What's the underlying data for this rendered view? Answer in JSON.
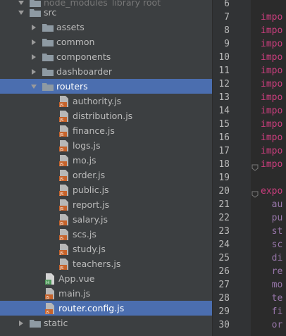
{
  "tree": {
    "top_row": {
      "label": "node_modules",
      "suffix": "library root"
    },
    "items": [
      {
        "label": "src",
        "kind": "folder",
        "depth": 1,
        "expanded": true,
        "selected": false
      },
      {
        "label": "assets",
        "kind": "folder",
        "depth": 2,
        "expanded": false,
        "selected": false
      },
      {
        "label": "common",
        "kind": "folder",
        "depth": 2,
        "expanded": false,
        "selected": false
      },
      {
        "label": "components",
        "kind": "folder",
        "depth": 2,
        "expanded": false,
        "selected": false
      },
      {
        "label": "dashboarder",
        "kind": "folder",
        "depth": 2,
        "expanded": false,
        "selected": false
      },
      {
        "label": "routers",
        "kind": "folder",
        "depth": 2,
        "expanded": true,
        "selected": true
      },
      {
        "label": "authority.js",
        "kind": "js",
        "depth": 3,
        "selected": false
      },
      {
        "label": "distribution.js",
        "kind": "js",
        "depth": 3,
        "selected": false
      },
      {
        "label": "finance.js",
        "kind": "js",
        "depth": 3,
        "selected": false
      },
      {
        "label": "logs.js",
        "kind": "js",
        "depth": 3,
        "selected": false
      },
      {
        "label": "mo.js",
        "kind": "js",
        "depth": 3,
        "selected": false
      },
      {
        "label": "order.js",
        "kind": "js",
        "depth": 3,
        "selected": false
      },
      {
        "label": "public.js",
        "kind": "js",
        "depth": 3,
        "selected": false
      },
      {
        "label": "report.js",
        "kind": "js",
        "depth": 3,
        "selected": false
      },
      {
        "label": "salary.js",
        "kind": "js",
        "depth": 3,
        "selected": false
      },
      {
        "label": "scs.js",
        "kind": "js",
        "depth": 3,
        "selected": false
      },
      {
        "label": "study.js",
        "kind": "js",
        "depth": 3,
        "selected": false
      },
      {
        "label": "teachers.js",
        "kind": "js",
        "depth": 3,
        "selected": false
      },
      {
        "label": "App.vue",
        "kind": "vue",
        "depth": 2,
        "selected": false
      },
      {
        "label": "main.js",
        "kind": "js",
        "depth": 2,
        "selected": false
      },
      {
        "label": "router.config.js",
        "kind": "js",
        "depth": 2,
        "selected": true
      },
      {
        "label": "static",
        "kind": "folder",
        "depth": 1,
        "expanded": false,
        "selected": false
      }
    ]
  },
  "editor": {
    "line_numbers": [
      "6",
      "7",
      "8",
      "9",
      "10",
      "11",
      "12",
      "13",
      "14",
      "15",
      "16",
      "17",
      "18",
      "19",
      "20",
      "21",
      "22",
      "23",
      "24",
      "25",
      "26",
      "27",
      "28",
      "29",
      "30"
    ],
    "lines": [
      {
        "text": "",
        "cls": ""
      },
      {
        "text": "impo",
        "cls": "kw"
      },
      {
        "text": "impo",
        "cls": "kw"
      },
      {
        "text": "impo",
        "cls": "kw"
      },
      {
        "text": "impo",
        "cls": "kw"
      },
      {
        "text": "impo",
        "cls": "kw"
      },
      {
        "text": "impo",
        "cls": "kw"
      },
      {
        "text": "impo",
        "cls": "kw"
      },
      {
        "text": "impo",
        "cls": "kw"
      },
      {
        "text": "impo",
        "cls": "kw"
      },
      {
        "text": "impo",
        "cls": "kw"
      },
      {
        "text": "impo",
        "cls": "kw"
      },
      {
        "text": "impo",
        "cls": "kw"
      },
      {
        "text": "",
        "cls": ""
      },
      {
        "text": "expo",
        "cls": "kw"
      },
      {
        "text": "  au",
        "cls": "prop"
      },
      {
        "text": "  pu",
        "cls": "prop"
      },
      {
        "text": "  st",
        "cls": "prop"
      },
      {
        "text": "  sc",
        "cls": "prop"
      },
      {
        "text": "  di",
        "cls": "prop"
      },
      {
        "text": "  re",
        "cls": "prop"
      },
      {
        "text": "  mo",
        "cls": "prop"
      },
      {
        "text": "  te",
        "cls": "prop"
      },
      {
        "text": "  fi",
        "cls": "prop"
      },
      {
        "text": "  or",
        "cls": "prop"
      }
    ]
  },
  "colors": {
    "tree_bg": "#3c3f41",
    "selection": "#4b6eaf",
    "folder": "#8e9aa3",
    "js_icon": "#c6632b",
    "vue_icon": "#4f9a5a",
    "keyword": "#cc3e7e"
  }
}
